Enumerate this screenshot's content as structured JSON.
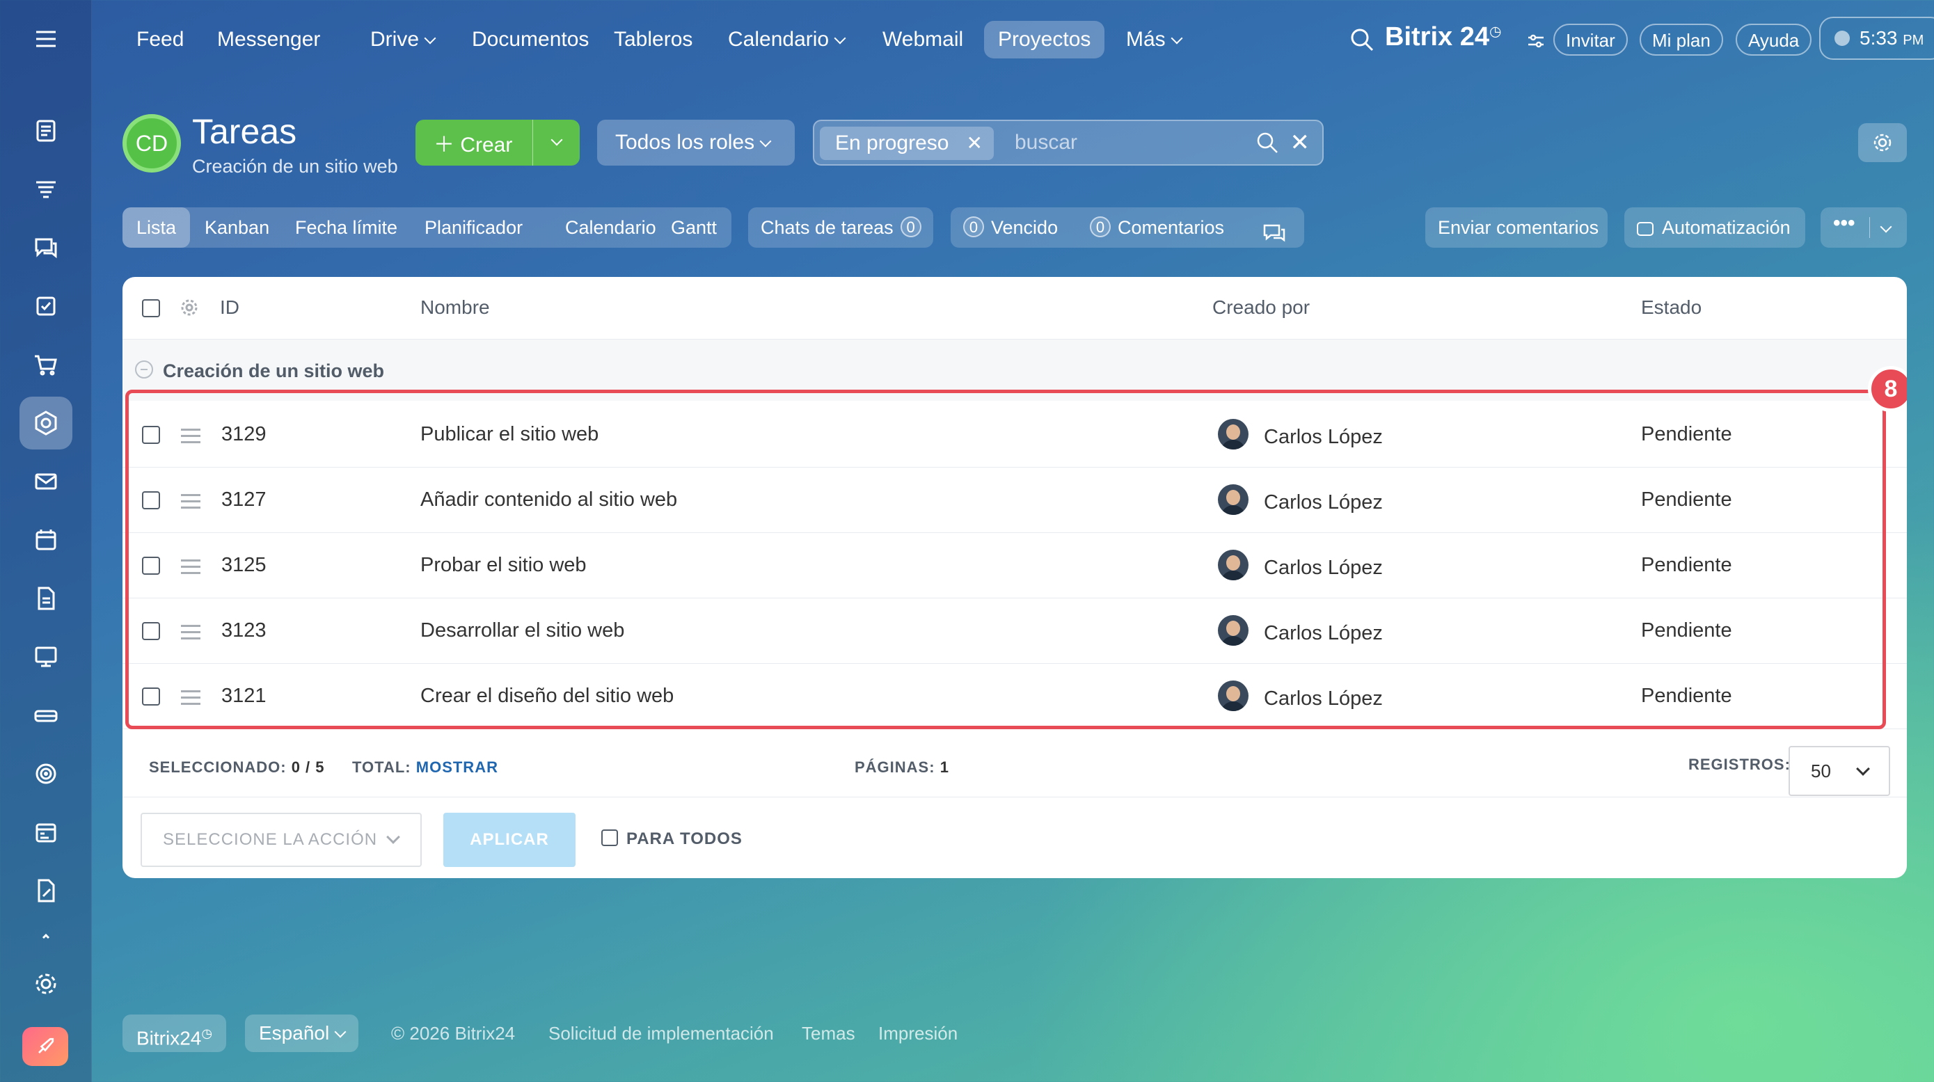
{
  "topnav": {
    "items": [
      "Feed",
      "Messenger",
      "Drive",
      "Documentos",
      "Tableros",
      "Calendario",
      "Webmail",
      "Proyectos",
      "Más"
    ],
    "active": "Proyectos",
    "brand": "Bitrix 24",
    "invite": "Invitar",
    "my_plan": "Mi plan",
    "help": "Ayuda",
    "time": "5:33",
    "time_suffix": "PM"
  },
  "header": {
    "logo_initials": "CD",
    "title": "Tareas",
    "subtitle": "Creación de un sitio web",
    "create_label": "Crear",
    "roles_label": "Todos los roles",
    "filter_chip": "En progreso",
    "search_placeholder": "buscar"
  },
  "views": {
    "tabs": [
      "Lista",
      "Kanban",
      "Fecha límite",
      "Planificador",
      "Calendario",
      "Gantt"
    ],
    "active": "Lista",
    "chats_label": "Chats de tareas",
    "chats_count": "0",
    "overdue_count": "0",
    "overdue_label": "Vencido",
    "comments_count": "0",
    "comments_label": "Comentarios",
    "send_feedback": "Enviar comentarios",
    "automation": "Automatización"
  },
  "table": {
    "columns": {
      "id": "ID",
      "name": "Nombre",
      "created_by": "Creado por",
      "status": "Estado"
    },
    "group_label": "Creación de un sitio web",
    "rows": [
      {
        "id": "3129",
        "name": "Publicar el sitio web",
        "creator": "Carlos López",
        "status": "Pendiente"
      },
      {
        "id": "3127",
        "name": "Añadir contenido al sitio web",
        "creator": "Carlos López",
        "status": "Pendiente"
      },
      {
        "id": "3125",
        "name": "Probar el sitio web",
        "creator": "Carlos López",
        "status": "Pendiente"
      },
      {
        "id": "3123",
        "name": "Desarrollar el sitio web",
        "creator": "Carlos López",
        "status": "Pendiente"
      },
      {
        "id": "3121",
        "name": "Crear el diseño del sitio web",
        "creator": "Carlos López",
        "status": "Pendiente"
      }
    ],
    "highlight_badge": "8"
  },
  "footer_bar": {
    "selected_label": "SELECCIONADO:",
    "selected_value": "0 / 5",
    "total_label": "TOTAL:",
    "total_link": "MOSTRAR",
    "pages_label": "PÁGINAS:",
    "pages_value": "1",
    "records_label": "REGISTROS:",
    "records_value": "50",
    "action_placeholder": "SELECCIONE LA ACCIÓN",
    "apply_label": "APLICAR",
    "for_all_label": "PARA TODOS"
  },
  "page_footer": {
    "brand": "Bitrix24",
    "language": "Español",
    "copyright": "© 2026 Bitrix24",
    "links": [
      "Solicitud de implementación",
      "Temas",
      "Impresión"
    ]
  },
  "colors": {
    "accent_green": "#5cc04a",
    "highlight_red": "#e84b55",
    "link_blue": "#2067b0"
  }
}
